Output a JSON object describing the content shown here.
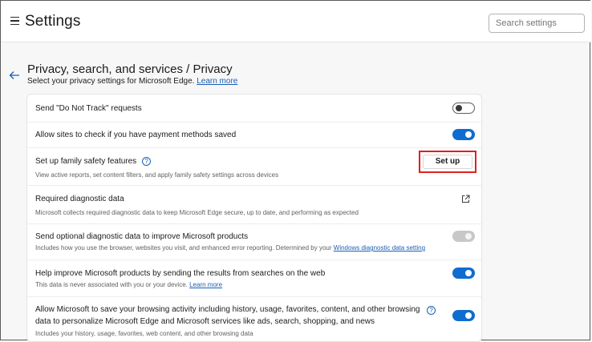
{
  "header": {
    "title": "Settings",
    "search_placeholder": "Search settings"
  },
  "page": {
    "title": "Privacy, search, and services / Privacy",
    "subtitle": "Select your privacy settings for Microsoft Edge.",
    "subtitle_link": "Learn more"
  },
  "rows": [
    {
      "title": "Send \"Do Not Track\" requests",
      "control": "toggle",
      "state": "off"
    },
    {
      "title": "Allow sites to check if you have payment methods saved",
      "control": "toggle",
      "state": "on"
    },
    {
      "title": "Set up family safety features",
      "desc": "View active reports, set content filters, and apply family safety settings across devices",
      "control": "button",
      "button_label": "Set up",
      "help_icon": "help-circle-icon"
    },
    {
      "title": "Required diagnostic data",
      "desc": "Microsoft collects required diagnostic data to keep Microsoft Edge secure, up to date, and performing as expected",
      "control": "external-link-icon"
    },
    {
      "title": "Send optional diagnostic data to improve Microsoft products",
      "desc": "Includes how you use the browser, websites you visit, and enhanced error reporting. Determined by your",
      "desc_link": "Windows diagnostic data setting",
      "control": "toggle",
      "state": "disabled"
    },
    {
      "title": "Help improve Microsoft products by sending the results from searches on the web",
      "desc": "This data is never associated with you or your device.",
      "desc_link": "Learn more",
      "control": "toggle",
      "state": "on"
    },
    {
      "title": "Allow Microsoft to save your browsing activity including history, usage, favorites, content, and other browsing",
      "title_line2": "data to personalize Microsoft Edge and Microsoft services like ads, search, shopping, and news",
      "desc": "Includes your history, usage, favorites, web content, and other browsing data",
      "control": "toggle",
      "state": "on",
      "help_icon": "help-circle-icon"
    }
  ],
  "colors": {
    "accent": "#0f6cd0",
    "highlight": "#e02020",
    "link": "#1a5fb4"
  }
}
